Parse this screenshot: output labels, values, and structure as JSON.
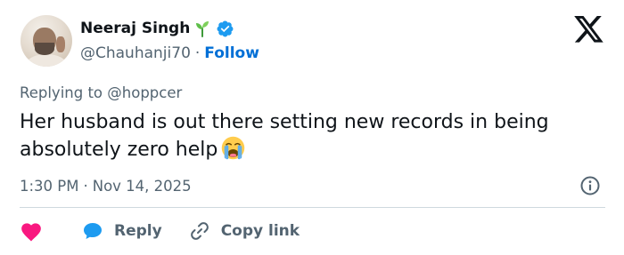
{
  "author": {
    "name": "Neeraj Singh",
    "handle": "@Chauhanji70",
    "separator": "·",
    "follow_label": "Follow"
  },
  "reply_context": "Replying to @hoppcer",
  "tweet": {
    "text": "Her husband is out there setting new records in being absolutely zero help",
    "emoji": "loudly-crying-face"
  },
  "meta": {
    "time": "1:30 PM",
    "separator": "·",
    "date": "Nov 14, 2025"
  },
  "actions": {
    "reply_label": "Reply",
    "copy_link_label": "Copy link"
  },
  "icons": {
    "name_badge": "seedling-icon",
    "verified": "verified-badge-icon",
    "platform": "x-logo",
    "info": "info-icon",
    "like": "heart-icon",
    "reply": "speech-bubble-icon",
    "copy": "link-icon"
  },
  "colors": {
    "text": "#0f1419",
    "secondary": "#536471",
    "follow": "#006fd6",
    "verified": "#1d9bf0",
    "heart": "#f91880",
    "reply_bubble": "#1d9bf0",
    "divider": "#cfd9de"
  }
}
